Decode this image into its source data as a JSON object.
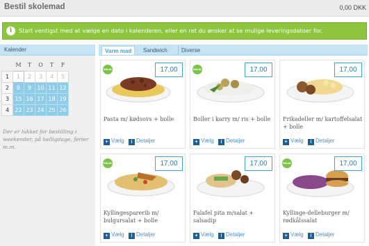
{
  "header": {
    "title": "Bestil skolemad",
    "total": "0,00 DKK"
  },
  "info": {
    "icon": "info-icon",
    "message": "Start ventigst med at vælge en dato i kalenderen, eller en ret du ønsker at se mulige leveringsdatoer for."
  },
  "calendar": {
    "title": "Kalender",
    "days": [
      "M",
      "T",
      "O",
      "T",
      "F"
    ],
    "weeks": [
      {
        "num": "1",
        "dates": [
          "1",
          "2",
          "3",
          "4",
          "5"
        ]
      },
      {
        "num": "2",
        "dates": [
          "8",
          "9",
          "10",
          "11",
          "12"
        ]
      },
      {
        "num": "3",
        "dates": [
          "15",
          "16",
          "17",
          "18",
          "19"
        ]
      },
      {
        "num": "4",
        "dates": [
          "22",
          "23",
          "24",
          "25",
          "26"
        ]
      }
    ],
    "note": "Der er lukket for bestilling i weekender, på helligdage, ferier m.m."
  },
  "tabs": [
    "Varm mad",
    "Sandwich",
    "Diverse"
  ],
  "actions": {
    "choose": "Vælg",
    "details": "Detaljer"
  },
  "products": [
    {
      "name": "Pasta m/ kødsovs + bolle",
      "price": "17,00",
      "badge": "HALAL"
    },
    {
      "name": "Boller i karry m/ ris + bolle",
      "price": "17,00",
      "badge": "HALAL"
    },
    {
      "name": "Frikadeller m/ kartoffelsalat + bolle",
      "price": "17,00",
      "badge": ""
    },
    {
      "name": "Kyllingesparerib m/ bulgursalat + bolle",
      "price": "17,00",
      "badge": "HALAL"
    },
    {
      "name": "Falafel pita m/salat + salsadip",
      "price": "17,00",
      "badge": ""
    },
    {
      "name": "Kyllinge-delleburger m/ rødkålssalat",
      "price": "17,00",
      "badge": "HALAL"
    }
  ],
  "colors": {
    "info_green": "#8cc63e",
    "tab_blue": "#c4e4f4",
    "available_day": "#8dcdea",
    "price_border": "#3fa6d8"
  }
}
